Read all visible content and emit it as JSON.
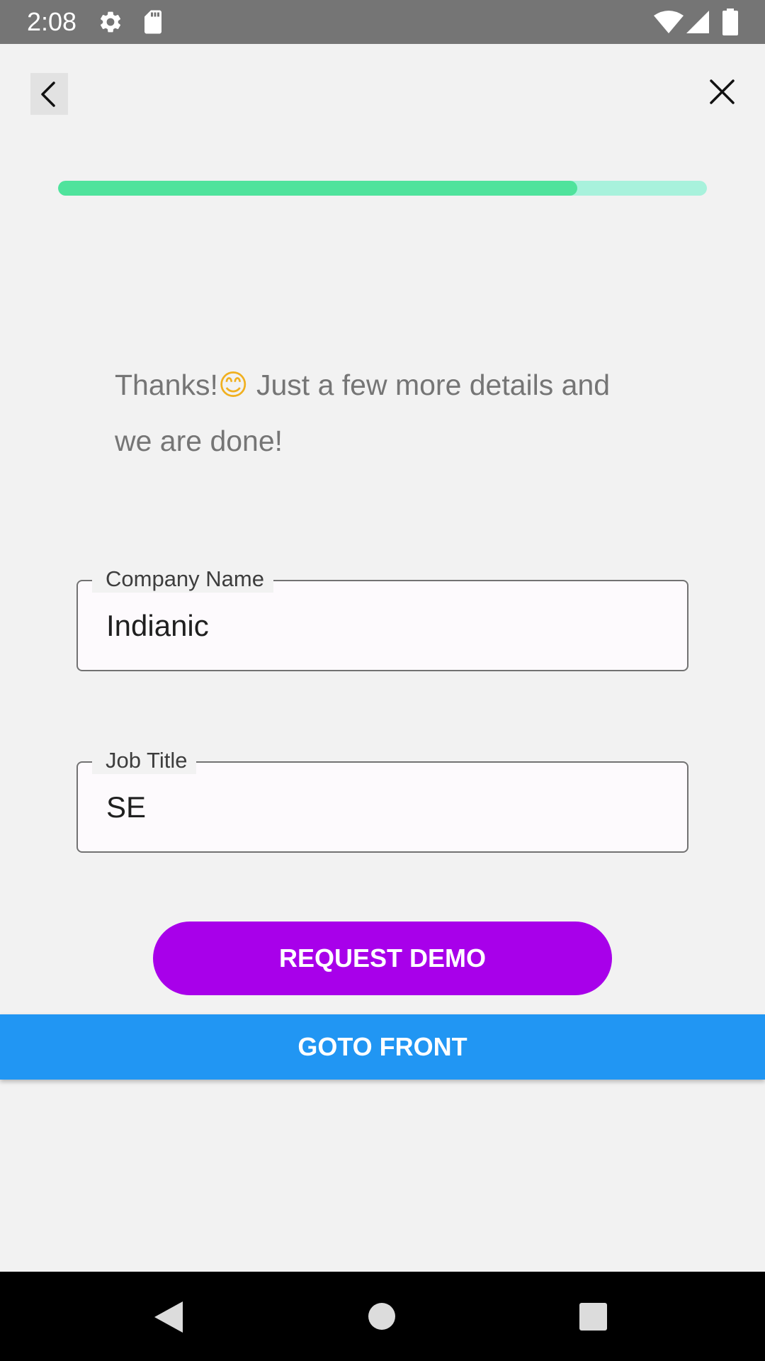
{
  "status_bar": {
    "time": "2:08",
    "icons": [
      "settings-icon",
      "sd-card-icon",
      "wifi-icon",
      "cell-signal-icon",
      "battery-icon"
    ]
  },
  "header": {
    "back_icon": "chevron-left-icon",
    "close_icon": "close-icon"
  },
  "progress": {
    "fraction": 0.8,
    "fill_color": "#4fe39c",
    "track_color": "#a8f2dc"
  },
  "message": {
    "text_before_emoji": "Thanks!",
    "emoji": "😊",
    "text_after_emoji": " Just a few more details and we are done!"
  },
  "form": {
    "company": {
      "label": "Company Name",
      "value": "Indianic"
    },
    "job": {
      "label": "Job Title",
      "value": "SE"
    }
  },
  "buttons": {
    "request_demo": "REQUEST DEMO",
    "goto_front": "GOTO FRONT"
  },
  "colors": {
    "request_demo_bg": "#a800ea",
    "goto_front_bg": "#2196f3",
    "status_bar_bg": "#757575"
  },
  "nav_bar": {
    "icons": [
      "back-triangle-icon",
      "home-circle-icon",
      "recents-square-icon"
    ]
  }
}
